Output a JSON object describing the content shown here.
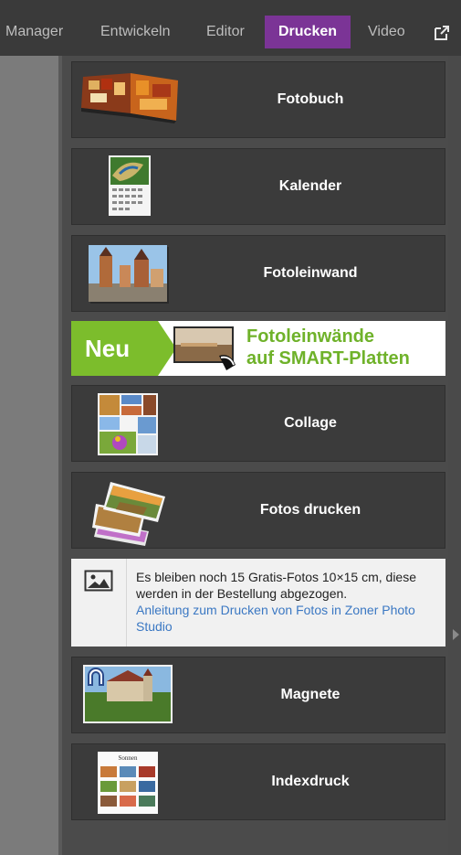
{
  "nav": {
    "tabs": [
      {
        "label": "Manager"
      },
      {
        "label": "Entwickeln"
      },
      {
        "label": "Editor"
      },
      {
        "label": "Drucken"
      },
      {
        "label": "Video"
      }
    ],
    "active_tab": "Drucken",
    "external_icon": "external-link-icon"
  },
  "products": {
    "fotobuch": "Fotobuch",
    "kalender": "Kalender",
    "fotoleinwand": "Fotoleinwand",
    "collage": "Collage",
    "fotos_drucken": "Fotos drucken",
    "magnete": "Magnete",
    "indexdruck": "Indexdruck"
  },
  "banner": {
    "badge": "Neu",
    "line1": "Fotoleinwände",
    "line2": "auf SMART-Platten"
  },
  "info": {
    "message": "Es bleiben noch 15 Gratis-Fotos 10×15 cm, diese werden in der Bestellung abgezogen.",
    "link": "Anleitung zum Drucken von Fotos in Zoner Photo Studio",
    "icon": "image-icon"
  },
  "thumb_text": {
    "indexdruck_title": "Sonnen"
  },
  "colors": {
    "accent": "#7b3496",
    "banner_green": "#7cbd2c",
    "link": "#3b78c3"
  }
}
